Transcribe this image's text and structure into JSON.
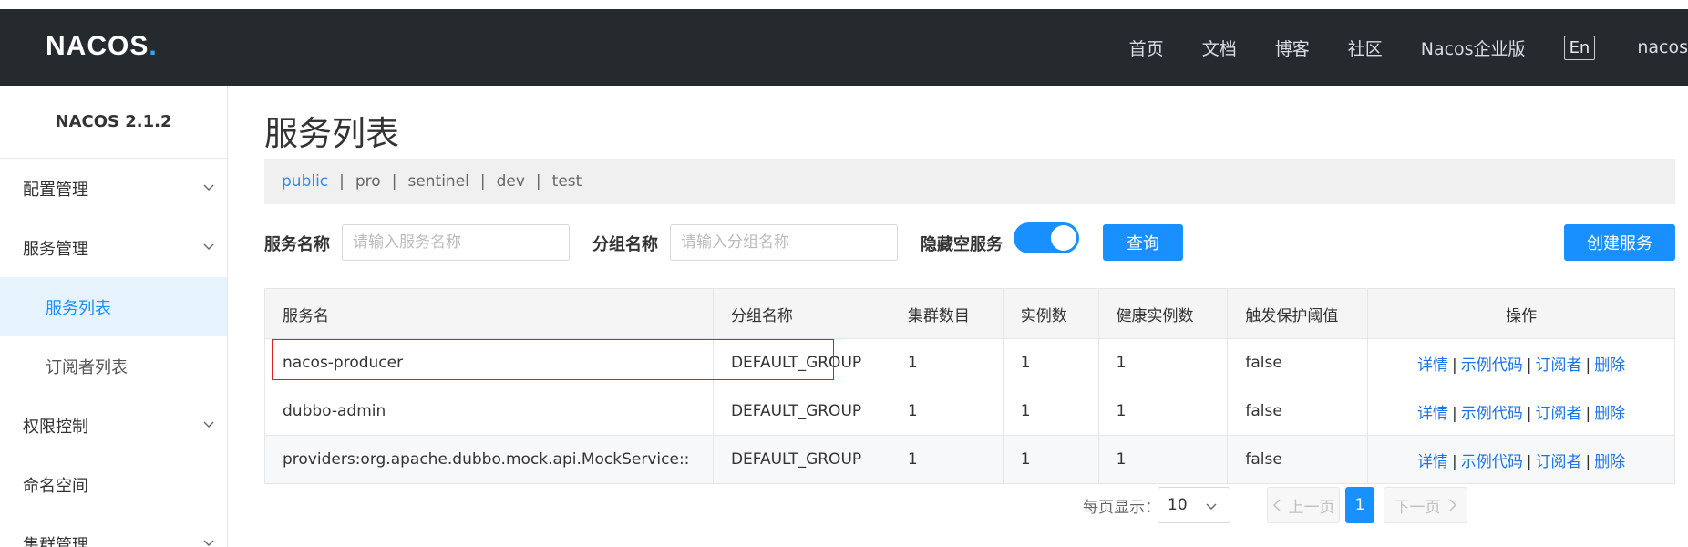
{
  "header": {
    "logo_main": "NAC",
    "logo_os": "OS",
    "logo_dot": ".",
    "nav": [
      "首页",
      "文档",
      "博客",
      "社区",
      "Nacos企业版"
    ],
    "lang": "En",
    "user": "nacos"
  },
  "sidebar": {
    "version": "NACOS 2.1.2",
    "items": [
      {
        "label": "配置管理"
      },
      {
        "label": "服务管理"
      },
      {
        "label": "服务列表"
      },
      {
        "label": "订阅者列表"
      },
      {
        "label": "权限控制"
      },
      {
        "label": "命名空间"
      },
      {
        "label": "集群管理"
      }
    ]
  },
  "main": {
    "title": "服务列表",
    "namespaces": [
      "public",
      "pro",
      "sentinel",
      "dev",
      "test"
    ],
    "active_namespace": "public",
    "filter": {
      "service_name_label": "服务名称",
      "service_name_placeholder": "请输入服务名称",
      "group_name_label": "分组名称",
      "group_name_placeholder": "请输入分组名称",
      "hide_empty_label": "隐藏空服务",
      "hide_empty_on": true,
      "query_button": "查询",
      "create_button": "创建服务"
    },
    "table": {
      "headers": [
        "服务名",
        "分组名称",
        "集群数目",
        "实例数",
        "健康实例数",
        "触发保护阈值",
        "操作"
      ],
      "rows": [
        {
          "name": "nacos-producer",
          "group": "DEFAULT_GROUP",
          "clusters": "1",
          "instances": "1",
          "healthy": "1",
          "threshold": "false"
        },
        {
          "name": "dubbo-admin",
          "group": "DEFAULT_GROUP",
          "clusters": "1",
          "instances": "1",
          "healthy": "1",
          "threshold": "false"
        },
        {
          "name": "providers:org.apache.dubbo.mock.api.MockService::",
          "group": "DEFAULT_GROUP",
          "clusters": "1",
          "instances": "1",
          "healthy": "1",
          "threshold": "false"
        }
      ],
      "ops": {
        "detail": "详情",
        "sample": "示例代码",
        "subscriber": "订阅者",
        "delete": "删除",
        "sep": "|"
      }
    },
    "pager": {
      "per_page_label": "每页显示：",
      "per_page": "10",
      "prev": "上一页",
      "next": "下一页",
      "current_page": "1"
    }
  },
  "colors": {
    "accent": "#1890ff",
    "header_bg": "#252a2f",
    "highlight": "#e02020"
  }
}
